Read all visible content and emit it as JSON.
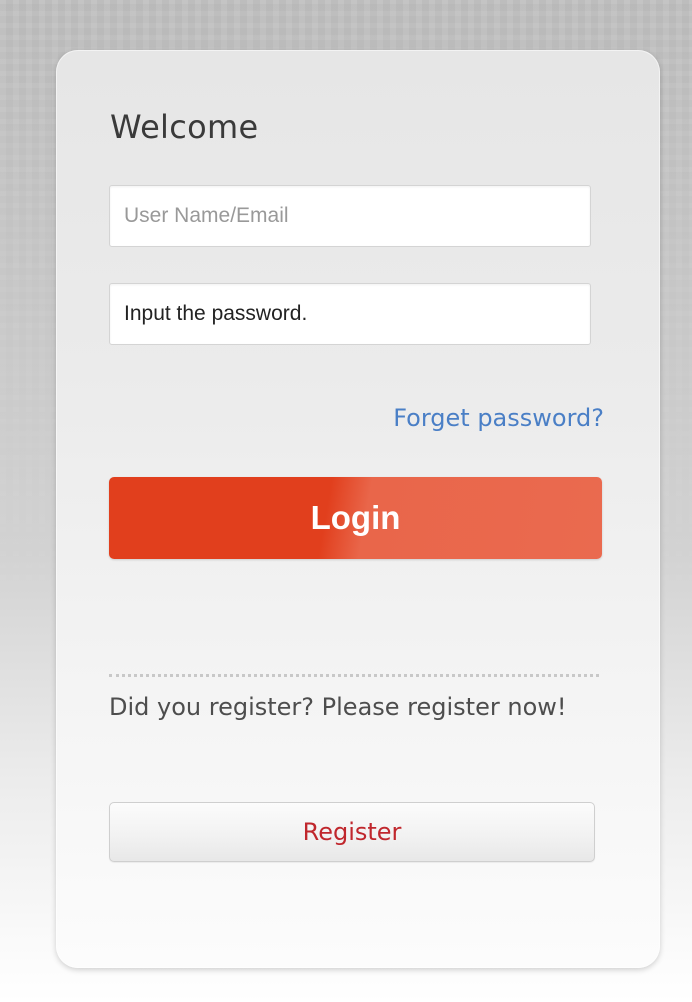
{
  "login_form": {
    "title": "Welcome",
    "username_placeholder": "User Name/Email",
    "password_value": "Input the password.",
    "forget_password_link": "Forget password?",
    "login_button": "Login",
    "register_prompt": "Did you register? Please register now!",
    "register_button": "Register"
  },
  "colors": {
    "login_button": "#e13f1d",
    "link": "#4a7fc6",
    "register_label": "#c0272d"
  }
}
